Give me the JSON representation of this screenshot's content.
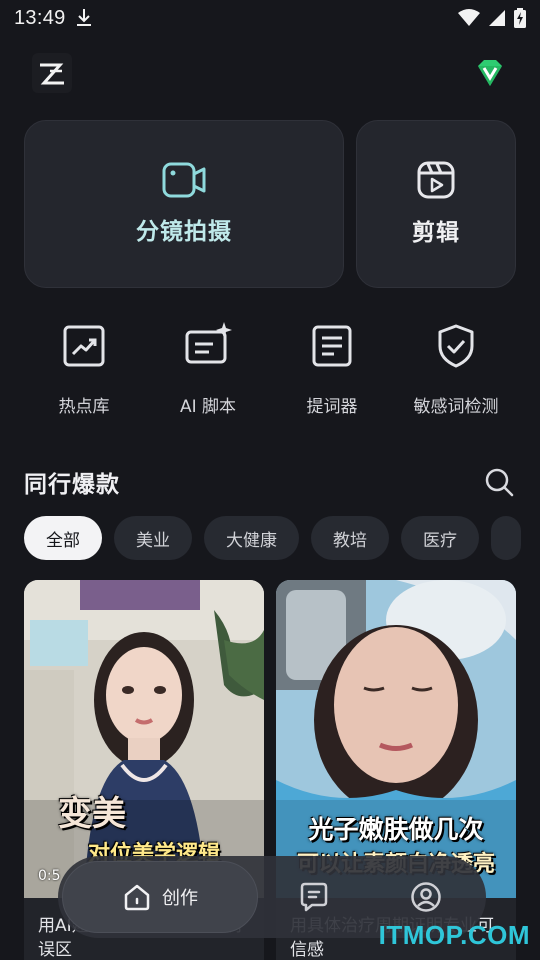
{
  "status_bar": {
    "time": "13:49",
    "icons": [
      "download-icon",
      "wifi-icon",
      "signal-icon",
      "battery-charging-icon"
    ]
  },
  "header": {
    "logo_icon": "app-logo",
    "vip_icon": "vip-diamond-icon"
  },
  "main_cards": {
    "shoot": {
      "label": "分镜拍摄",
      "icon": "video-camera-icon"
    },
    "edit": {
      "label": "剪辑",
      "icon": "clapperboard-play-icon"
    }
  },
  "tools": [
    {
      "label": "热点库",
      "icon": "trending-chart-icon"
    },
    {
      "label": "AI 脚本",
      "icon": "ai-script-icon"
    },
    {
      "label": "提词器",
      "icon": "teleprompter-icon"
    },
    {
      "label": "敏感词检测",
      "icon": "shield-check-icon"
    }
  ],
  "section": {
    "title": "同行爆款",
    "search_icon": "search-icon"
  },
  "chips": [
    "全部",
    "美业",
    "大健康",
    "教培",
    "医疗"
  ],
  "videos": [
    {
      "overlay_big": "变美",
      "overlay_small": "对位美学逻辑",
      "duration": "0:5",
      "title": "用AI建塑图可视化面部控例误区"
    },
    {
      "overlay_big": "光子嫩肤做几次",
      "overlay_small": "可以让素颜白净透亮",
      "title": "用具体治疗周期证明专业可信感"
    }
  ],
  "bottom_nav": {
    "create": "创作",
    "items": [
      "message-icon",
      "profile-icon"
    ]
  },
  "watermark": "ITMOP.COM",
  "colors": {
    "background": "#16171c",
    "card": "#24262d",
    "accent_teal": "#bfe9ea",
    "vip_green": "#2ecc71",
    "watermark": "#2fc6d9"
  }
}
